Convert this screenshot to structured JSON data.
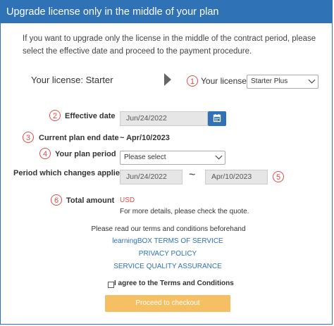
{
  "header": {
    "title": "Upgrade license only in the middle of your plan"
  },
  "intro": "If you want to upgrade only the license in the middle of the contract period, please select the effective date and proceed to the payment procedure.",
  "license": {
    "current": "Your license: Starter",
    "marker": "1",
    "label": "Your license",
    "selected": "Starter Plus"
  },
  "effective_date": {
    "marker": "2",
    "label": "Effective date",
    "value": "Jun/24/2022"
  },
  "plan_end": {
    "marker": "3",
    "label": "Current plan end date",
    "value": "~ Apr/10/2023"
  },
  "plan_period": {
    "marker": "4",
    "label": "Your plan period",
    "placeholder": "Please select"
  },
  "period_changes": {
    "label": "Period which changes applied",
    "start": "Jun/24/2022",
    "separator": "~",
    "end": "Apr/10/2023",
    "marker": "5"
  },
  "total": {
    "marker": "6",
    "label": "Total amount",
    "currency": "USD",
    "note": "For more details, please check the quote."
  },
  "terms": {
    "intro": "Please read our terms and conditions beforehand",
    "links": [
      "learningBOX TERMS OF SERVICE",
      "PRIVACY POLICY",
      "SERVICE QUALITY ASSURANCE"
    ],
    "agree_label": "I agree to the Terms and Conditions"
  },
  "checkout_button": "Proceed to checkout",
  "colors": {
    "primary": "#2f72b5",
    "accent_red": "#e24b4b",
    "checkout": "#f5c063"
  }
}
